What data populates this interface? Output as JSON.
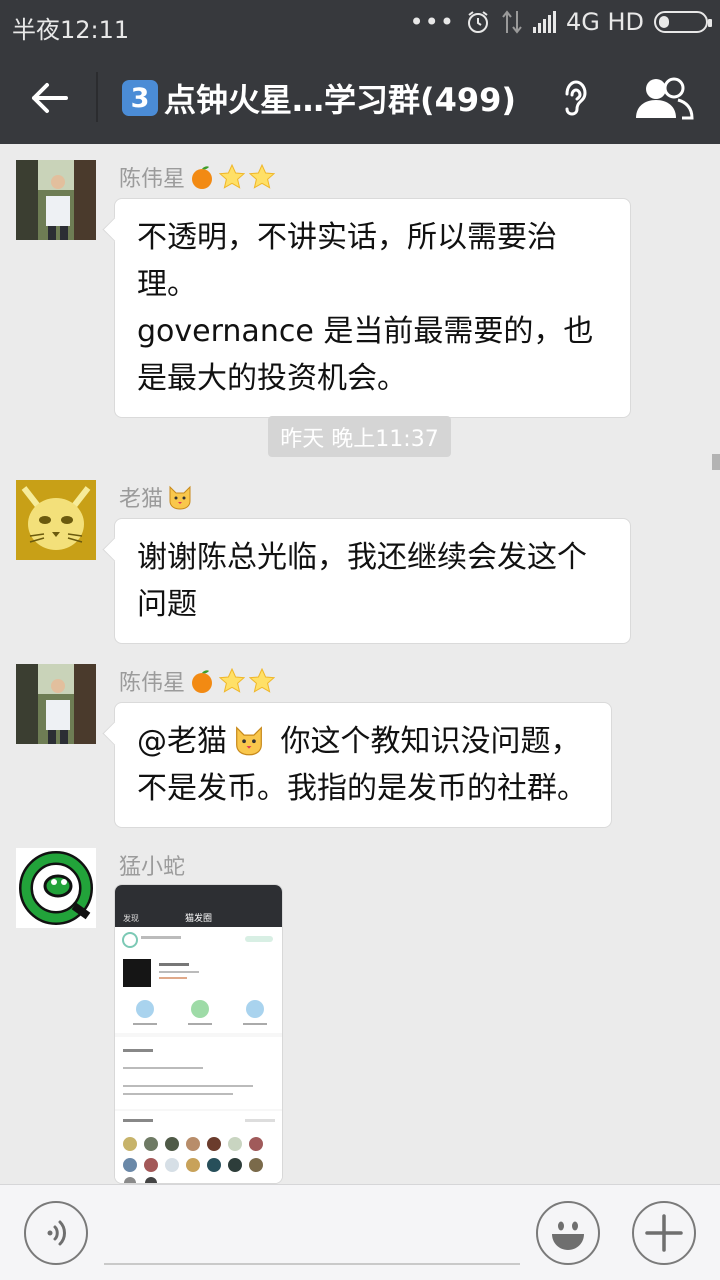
{
  "status": {
    "time": "半夜12:11",
    "dots": "•••",
    "network": "4G HD"
  },
  "header": {
    "keycap": "3",
    "title": "点钟火星…学习群(499)"
  },
  "messages": [
    {
      "sender": "陈伟星",
      "text_lines": [
        "不透明，不讲实话，所以需要治理。",
        "governance 是当前最需要的，也",
        "是最大的投资机会。"
      ]
    },
    {
      "timestamp": "昨天 晚上11:37"
    },
    {
      "sender": "老猫",
      "text_lines": [
        "谢谢陈总光临，我还继续会发这个",
        "问题"
      ]
    },
    {
      "sender": "陈伟星",
      "mention": "@老猫",
      "text_lines": [
        "你这个教知识没问题，",
        "不是发币。我指的是发币的社群。"
      ]
    },
    {
      "sender": "猛小蛇",
      "image_texts": {
        "back": "发现",
        "title": "猫发圈"
      }
    }
  ],
  "colors": {
    "bar": "#37393d",
    "chat_bg": "#ebebeb",
    "bubble": "#ffffff",
    "keycap": "#4b8cd6",
    "snake_green": "#22a33a"
  },
  "icons": [
    "back-arrow-icon",
    "listen-ear-icon",
    "group-members-icon",
    "voice-input-icon",
    "emoji-icon",
    "plus-icon",
    "tangerine-icon",
    "star-icon",
    "cat-face-icon"
  ]
}
